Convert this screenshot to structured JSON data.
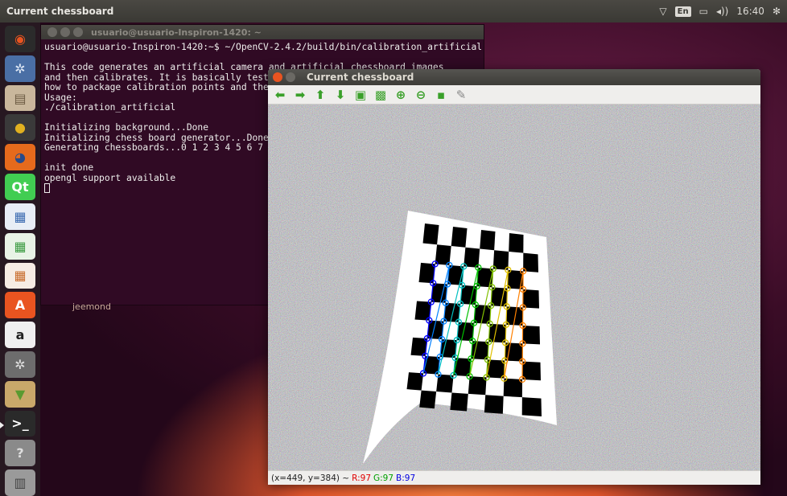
{
  "topbar": {
    "title": "Current chessboard",
    "keyboard": "En",
    "clock": "16:40"
  },
  "launcher": {
    "items": [
      {
        "name": "dash-icon",
        "glyph": "◉",
        "bg": "#2b2b2b",
        "fg": "#e95420"
      },
      {
        "name": "settings-gear-icon",
        "glyph": "✲",
        "bg": "#4a6fa5",
        "fg": "#dfe8f5"
      },
      {
        "name": "file-manager-icon",
        "glyph": "▤",
        "bg": "#c9b79c",
        "fg": "#6b5a42"
      },
      {
        "name": "chrome-icon",
        "glyph": "●",
        "bg": "#3a3a3a",
        "fg": "#e0b020"
      },
      {
        "name": "firefox-icon",
        "glyph": "◕",
        "bg": "#e66a1c",
        "fg": "#284a8a"
      },
      {
        "name": "qt-creator-icon",
        "glyph": "Qt",
        "bg": "#41cd52",
        "fg": "#ffffff"
      },
      {
        "name": "libreoffice-writer-icon",
        "glyph": "▦",
        "bg": "#e8eef6",
        "fg": "#3a6ab0"
      },
      {
        "name": "libreoffice-calc-icon",
        "glyph": "▦",
        "bg": "#e8f3e6",
        "fg": "#3a9a40"
      },
      {
        "name": "libreoffice-impress-icon",
        "glyph": "▦",
        "bg": "#f6ece4",
        "fg": "#c86a2a"
      },
      {
        "name": "software-center-icon",
        "glyph": "A",
        "bg": "#e95420",
        "fg": "#ffffff"
      },
      {
        "name": "amazon-icon",
        "glyph": "a",
        "bg": "#f0f0f0",
        "fg": "#222222"
      },
      {
        "name": "system-settings-icon",
        "glyph": "✲",
        "bg": "#6d6d6d",
        "fg": "#e0e0e0"
      },
      {
        "name": "archive-manager-icon",
        "glyph": "▼",
        "bg": "#c9a86a",
        "fg": "#5a9a30"
      },
      {
        "name": "terminal-icon",
        "glyph": ">_",
        "bg": "#2a2a2a",
        "fg": "#ffffff"
      },
      {
        "name": "help-icon",
        "glyph": "?",
        "bg": "#8a8a8a",
        "fg": "#dddddd"
      },
      {
        "name": "trash-icon",
        "glyph": "▥",
        "bg": "#9a9a9a",
        "fg": "#444444"
      }
    ]
  },
  "terminal": {
    "title": "usuario@usuario-Inspiron-1420: ~",
    "lines": [
      "usuario@usuario-Inspiron-1420:~$ ~/OpenCV-2.4.2/build/bin/calibration_artificial",
      "",
      "This code generates an artificial camera and artificial chessboard images",
      "and then calibrates. It is basically test",
      "how to package calibration points and the",
      "Usage:",
      "./calibration_artificial",
      "",
      "Initializing background...Done",
      "Initializing chess board generator...Done",
      "Generating chessboards...0 1 2 3 4 5 6 7",
      "",
      "init done",
      "opengl support available"
    ],
    "below_text": "jeemond"
  },
  "window": {
    "title": "Current chessboard",
    "toolbar": [
      {
        "name": "pan-left-icon",
        "glyph": "⬅",
        "color": "#3aa02a"
      },
      {
        "name": "pan-right-icon",
        "glyph": "➡",
        "color": "#3aa02a"
      },
      {
        "name": "pan-up-icon",
        "glyph": "⬆",
        "color": "#3aa02a"
      },
      {
        "name": "pan-down-icon",
        "glyph": "⬇",
        "color": "#3aa02a"
      },
      {
        "name": "zoom-fit-icon",
        "glyph": "▣",
        "color": "#3aa02a"
      },
      {
        "name": "zoom-x1-icon",
        "glyph": "▩",
        "color": "#3aa02a"
      },
      {
        "name": "zoom-in-icon",
        "glyph": "⊕",
        "color": "#3aa02a"
      },
      {
        "name": "zoom-out-icon",
        "glyph": "⊖",
        "color": "#3aa02a"
      },
      {
        "name": "save-icon",
        "glyph": "▪",
        "color": "#3aa02a"
      },
      {
        "name": "properties-brush-icon",
        "glyph": "✎",
        "color": "#888888"
      }
    ],
    "status": {
      "coords": "(x=449, y=384) ~",
      "r": "R:97",
      "g": "G:97",
      "b": "B:97",
      "r_color": "#e00000",
      "g_color": "#00a000",
      "b_color": "#0000e0"
    }
  }
}
